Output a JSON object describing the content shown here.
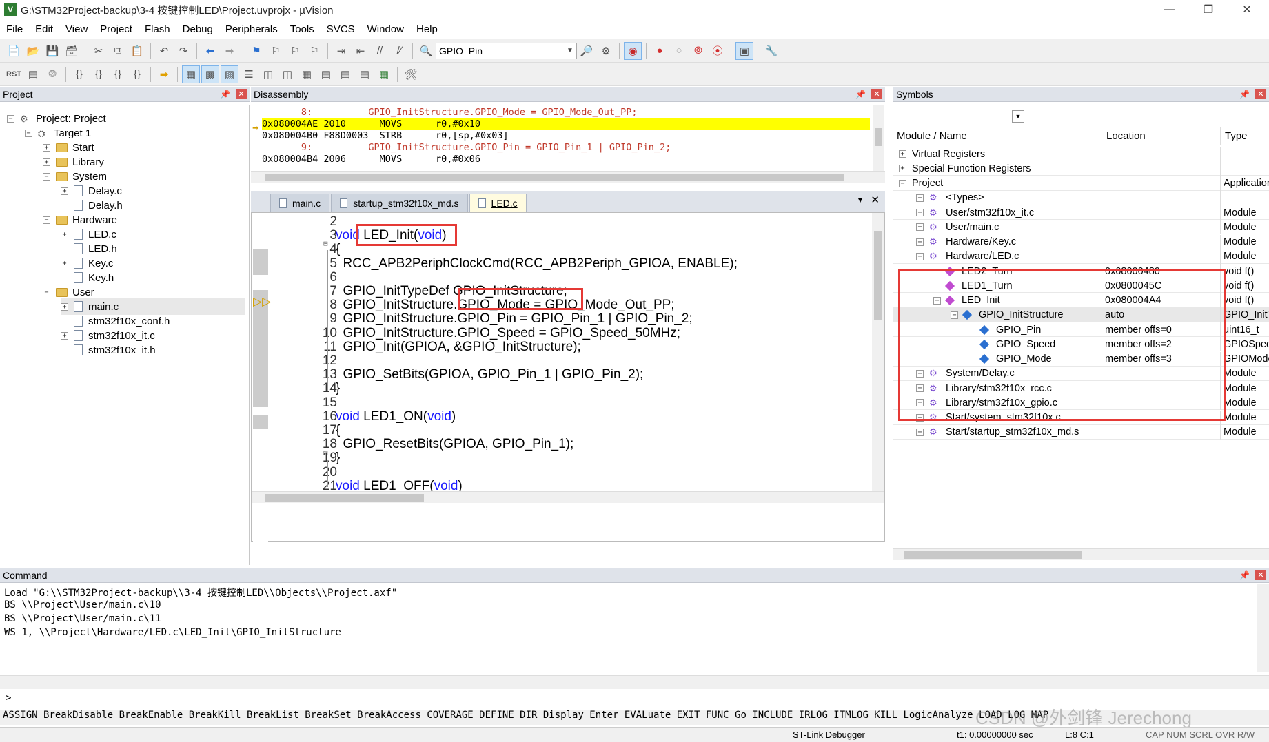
{
  "window": {
    "title": "G:\\STM32Project-backup\\3-4 按键控制LED\\Project.uvprojx - µVision",
    "app_icon": "V"
  },
  "menu": [
    "File",
    "Edit",
    "View",
    "Project",
    "Flash",
    "Debug",
    "Peripherals",
    "Tools",
    "SVCS",
    "Window",
    "Help"
  ],
  "toolbar": {
    "find_combo_value": "GPIO_Pin"
  },
  "project_panel": {
    "title": "Project",
    "items": [
      {
        "label": "Project: Project",
        "depth": 0,
        "kind": "project",
        "exp": "-"
      },
      {
        "label": "Target 1",
        "depth": 1,
        "kind": "target",
        "exp": "-"
      },
      {
        "label": "Start",
        "depth": 2,
        "kind": "folder",
        "exp": "+"
      },
      {
        "label": "Library",
        "depth": 2,
        "kind": "folder",
        "exp": "+"
      },
      {
        "label": "System",
        "depth": 2,
        "kind": "folder",
        "exp": "-"
      },
      {
        "label": "Delay.c",
        "depth": 3,
        "kind": "file",
        "exp": "+"
      },
      {
        "label": "Delay.h",
        "depth": 3,
        "kind": "file",
        "exp": ""
      },
      {
        "label": "Hardware",
        "depth": 2,
        "kind": "folder",
        "exp": "-"
      },
      {
        "label": "LED.c",
        "depth": 3,
        "kind": "file",
        "exp": "+"
      },
      {
        "label": "LED.h",
        "depth": 3,
        "kind": "file",
        "exp": ""
      },
      {
        "label": "Key.c",
        "depth": 3,
        "kind": "file",
        "exp": "+"
      },
      {
        "label": "Key.h",
        "depth": 3,
        "kind": "file",
        "exp": ""
      },
      {
        "label": "User",
        "depth": 2,
        "kind": "folder",
        "exp": "-"
      },
      {
        "label": "main.c",
        "depth": 3,
        "kind": "file",
        "exp": "+"
      },
      {
        "label": "stm32f10x_conf.h",
        "depth": 3,
        "kind": "file",
        "exp": ""
      },
      {
        "label": "stm32f10x_it.c",
        "depth": 3,
        "kind": "file",
        "exp": "+"
      },
      {
        "label": "stm32f10x_it.h",
        "depth": 3,
        "kind": "file",
        "exp": ""
      }
    ]
  },
  "disassembly": {
    "title": "Disassembly",
    "lines": [
      {
        "text": "       8:          GPIO_InitStructure.GPIO_Mode = GPIO_Mode_Out_PP;",
        "kind": "src"
      },
      {
        "text": "0x080004AE 2010      MOVS      r0,#0x10",
        "kind": "cur"
      },
      {
        "text": "0x080004B0 F88D0003  STRB      r0,[sp,#0x03]",
        "kind": "asm"
      },
      {
        "text": "       9:          GPIO_InitStructure.GPIO_Pin = GPIO_Pin_1 | GPIO_Pin_2;",
        "kind": "src"
      },
      {
        "text": "0x080004B4 2006      MOVS      r0,#0x06",
        "kind": "asm"
      }
    ]
  },
  "editor": {
    "tabs": [
      "main.c",
      "startup_stm32f10x_md.s",
      "LED.c"
    ],
    "active_tab": 2,
    "lines": [
      {
        "n": "2",
        "parts": [
          {
            "t": ""
          }
        ]
      },
      {
        "n": "3",
        "parts": [
          {
            "t": "void",
            "kw": true
          },
          {
            "t": " LED_Init("
          },
          {
            "t": "void",
            "kw": true
          },
          {
            "t": ")"
          }
        ]
      },
      {
        "n": "4",
        "parts": [
          {
            "t": "{"
          }
        ]
      },
      {
        "n": "5",
        "parts": [
          {
            "t": "  RCC_APB2PeriphClockCmd(RCC_APB2Periph_GPIOA, ENABLE);"
          }
        ]
      },
      {
        "n": "6",
        "parts": [
          {
            "t": ""
          }
        ]
      },
      {
        "n": "7",
        "parts": [
          {
            "t": "  GPIO_InitTypeDef GPIO_InitStructure;"
          }
        ]
      },
      {
        "n": "8",
        "parts": [
          {
            "t": "  GPIO_InitStructure.GPIO_Mode = GPIO_Mode_Out_PP;"
          }
        ]
      },
      {
        "n": "9",
        "parts": [
          {
            "t": "  GPIO_InitStructure.GPIO_Pin = GPIO_Pin_1 | GPIO_Pin_2;"
          }
        ]
      },
      {
        "n": "10",
        "parts": [
          {
            "t": "  GPIO_InitStructure.GPIO_Speed = GPIO_Speed_50MHz;"
          }
        ]
      },
      {
        "n": "11",
        "parts": [
          {
            "t": "  GPIO_Init(GPIOA, &GPIO_InitStructure);"
          }
        ]
      },
      {
        "n": "12",
        "parts": [
          {
            "t": ""
          }
        ]
      },
      {
        "n": "13",
        "parts": [
          {
            "t": "  GPIO_SetBits(GPIOA, GPIO_Pin_1 | GPIO_Pin_2);"
          }
        ]
      },
      {
        "n": "14",
        "parts": [
          {
            "t": "}"
          }
        ]
      },
      {
        "n": "15",
        "parts": [
          {
            "t": ""
          }
        ]
      },
      {
        "n": "16",
        "parts": [
          {
            "t": "void",
            "kw": true
          },
          {
            "t": " LED1_ON("
          },
          {
            "t": "void",
            "kw": true
          },
          {
            "t": ")"
          }
        ]
      },
      {
        "n": "17",
        "parts": [
          {
            "t": "{"
          }
        ]
      },
      {
        "n": "18",
        "parts": [
          {
            "t": "  GPIO_ResetBits(GPIOA, GPIO_Pin_1);"
          }
        ]
      },
      {
        "n": "19",
        "parts": [
          {
            "t": "}"
          }
        ]
      },
      {
        "n": "20",
        "parts": [
          {
            "t": ""
          }
        ]
      },
      {
        "n": "21",
        "parts": [
          {
            "t": "void",
            "kw": true
          },
          {
            "t": " LED1_OFF("
          },
          {
            "t": "void",
            "kw": true
          },
          {
            "t": ")"
          }
        ]
      }
    ]
  },
  "symbols": {
    "title": "Symbols",
    "columns": [
      "Module / Name",
      "Location",
      "Type"
    ],
    "rows": [
      {
        "name": "Virtual Registers",
        "indent": 0,
        "exp": "+",
        "icon": "",
        "loc": "",
        "type": ""
      },
      {
        "name": "Special Function Registers",
        "indent": 0,
        "exp": "+",
        "icon": "",
        "loc": "",
        "type": ""
      },
      {
        "name": "Project",
        "indent": 0,
        "exp": "-",
        "icon": "",
        "loc": "",
        "type": "Application"
      },
      {
        "name": "<Types>",
        "indent": 1,
        "exp": "+",
        "icon": "mod",
        "loc": "",
        "type": ""
      },
      {
        "name": "User/stm32f10x_it.c",
        "indent": 1,
        "exp": "+",
        "icon": "mod",
        "loc": "",
        "type": "Module"
      },
      {
        "name": "User/main.c",
        "indent": 1,
        "exp": "+",
        "icon": "mod",
        "loc": "",
        "type": "Module"
      },
      {
        "name": "Hardware/Key.c",
        "indent": 1,
        "exp": "+",
        "icon": "mod",
        "loc": "",
        "type": "Module"
      },
      {
        "name": "Hardware/LED.c",
        "indent": 1,
        "exp": "-",
        "icon": "mod",
        "loc": "",
        "type": "Module"
      },
      {
        "name": "LED2_Turn",
        "indent": 2,
        "exp": "",
        "icon": "fn",
        "loc": "0x08000480",
        "type": "void f()"
      },
      {
        "name": "LED1_Turn",
        "indent": 2,
        "exp": "",
        "icon": "fn",
        "loc": "0x0800045C",
        "type": "void f()"
      },
      {
        "name": "LED_Init",
        "indent": 2,
        "exp": "-",
        "icon": "fn",
        "loc": "0x080004A4",
        "type": "void f()"
      },
      {
        "name": "GPIO_InitStructure",
        "indent": 3,
        "exp": "-",
        "icon": "var",
        "loc": "auto",
        "type": "GPIO_InitTypeDef"
      },
      {
        "name": "GPIO_Pin",
        "indent": 4,
        "exp": "",
        "icon": "var",
        "loc": "member offs=0",
        "type": "uint16_t"
      },
      {
        "name": "GPIO_Speed",
        "indent": 4,
        "exp": "",
        "icon": "var",
        "loc": "member offs=2",
        "type": "GPIOSpeed_TypeDef"
      },
      {
        "name": "GPIO_Mode",
        "indent": 4,
        "exp": "",
        "icon": "var",
        "loc": "member offs=3",
        "type": "GPIOMode_TypeDef"
      },
      {
        "name": "System/Delay.c",
        "indent": 1,
        "exp": "+",
        "icon": "mod",
        "loc": "",
        "type": "Module"
      },
      {
        "name": "Library/stm32f10x_rcc.c",
        "indent": 1,
        "exp": "+",
        "icon": "mod",
        "loc": "",
        "type": "Module"
      },
      {
        "name": "Library/stm32f10x_gpio.c",
        "indent": 1,
        "exp": "+",
        "icon": "mod",
        "loc": "",
        "type": "Module"
      },
      {
        "name": "Start/system_stm32f10x.c",
        "indent": 1,
        "exp": "+",
        "icon": "mod",
        "loc": "",
        "type": "Module"
      },
      {
        "name": "Start/startup_stm32f10x_md.s",
        "indent": 1,
        "exp": "+",
        "icon": "mod",
        "loc": "",
        "type": "Module"
      }
    ]
  },
  "command": {
    "title": "Command",
    "output": [
      "Load \"G:\\\\STM32Project-backup\\\\3-4 按键控制LED\\\\Objects\\\\Project.axf\"",
      "BS \\\\Project\\User/main.c\\10",
      "BS \\\\Project\\User/main.c\\11",
      "WS 1, \\\\Project\\Hardware/LED.c\\LED_Init\\GPIO_InitStructure"
    ],
    "prompt": ">",
    "help": "ASSIGN BreakDisable BreakEnable BreakKill BreakList BreakSet BreakAccess COVERAGE DEFINE DIR Display Enter EVALuate EXIT FUNC Go INCLUDE IRLOG ITMLOG KILL LogicAnalyze LOAD LOG MAP"
  },
  "status": {
    "debugger": "ST-Link Debugger",
    "time": "t1: 0.00000000 sec",
    "pos": "L:8 C:1",
    "flags": "CAP NUM SCRL OVR R/W"
  },
  "watermark": "CSDN @外剑锋 Jerechong",
  "colors": {
    "highlight": "#ffff00",
    "keyword": "#1a1aff",
    "annotation": "#e53935",
    "source_line": "#c0392b"
  }
}
